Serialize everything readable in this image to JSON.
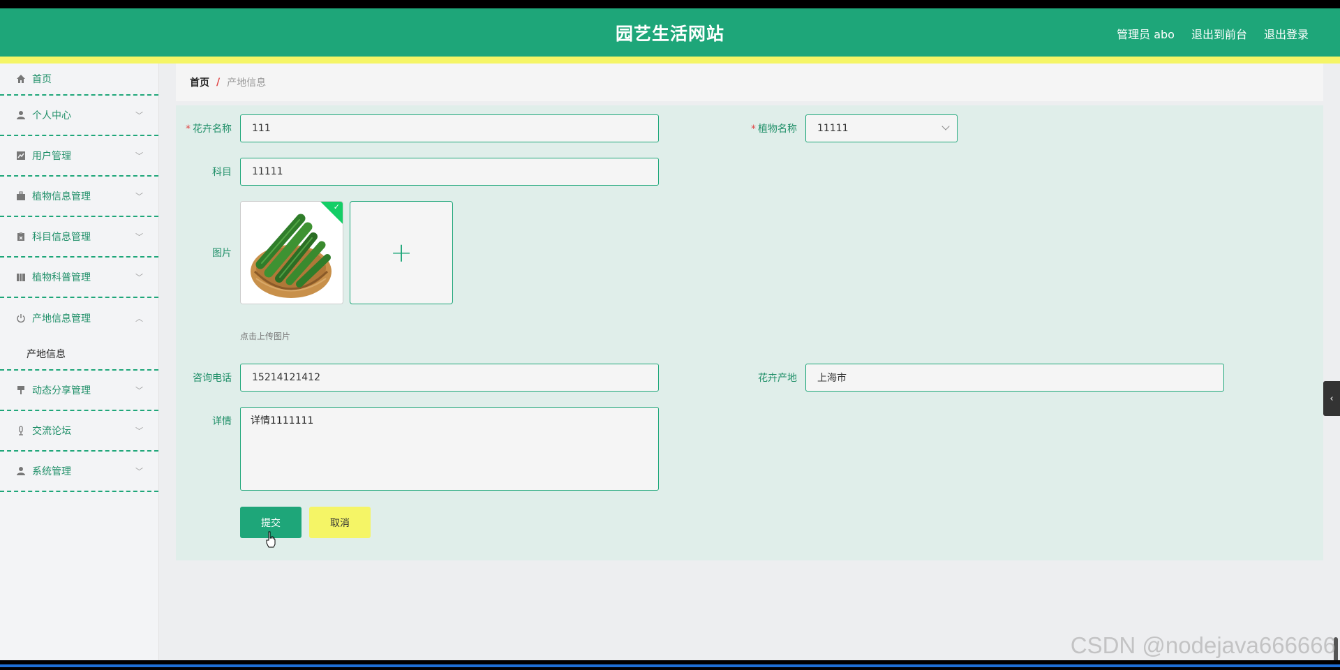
{
  "header": {
    "title": "园艺生活网站",
    "links": [
      "管理员 abo",
      "退出到前台",
      "退出登录"
    ]
  },
  "sidebar": {
    "items": [
      {
        "label": "首页",
        "icon": "home-icon"
      },
      {
        "label": "个人中心",
        "icon": "user-icon"
      },
      {
        "label": "用户管理",
        "icon": "chart-icon"
      },
      {
        "label": "植物信息管理",
        "icon": "briefcase-icon"
      },
      {
        "label": "科目信息管理",
        "icon": "clipboard-icon"
      },
      {
        "label": "植物科普管理",
        "icon": "library-icon"
      },
      {
        "label": "产地信息管理",
        "icon": "power-icon"
      },
      {
        "label": "动态分享管理",
        "icon": "brush-icon"
      },
      {
        "label": "交流论坛",
        "icon": "microphone-icon"
      },
      {
        "label": "系统管理",
        "icon": "user-icon"
      }
    ],
    "active_sub": "产地信息"
  },
  "breadcrumb": {
    "home": "首页",
    "separator": "/",
    "current": "产地信息"
  },
  "form": {
    "flower_name": {
      "label": "花卉名称",
      "value": "111"
    },
    "plant_name": {
      "label": "植物名称",
      "value": "11111"
    },
    "subject": {
      "label": "科目",
      "value": "11111"
    },
    "image": {
      "label": "图片",
      "hint": "点击上传图片"
    },
    "phone": {
      "label": "咨询电话",
      "value": "15214121412"
    },
    "origin": {
      "label": "花卉产地",
      "value": "上海市"
    },
    "details": {
      "label": "详情",
      "value": "详情1111111"
    },
    "submit": "提交",
    "cancel": "取消"
  },
  "watermark": "CSDN @nodejava666666",
  "colors": {
    "primary": "#1ea679",
    "accent": "#f5f566",
    "form_bg": "#e0eeea"
  }
}
